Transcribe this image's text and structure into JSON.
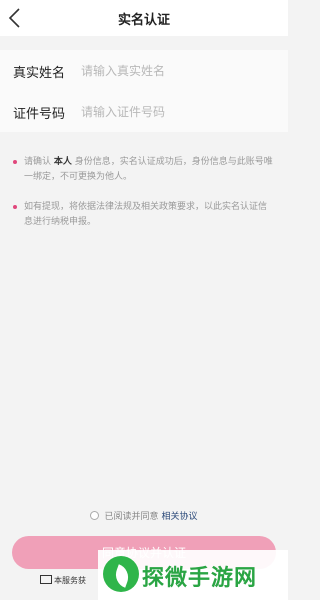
{
  "header": {
    "title": "实名认证",
    "back_icon": "chevron-left-icon"
  },
  "form": {
    "name": {
      "label": "真实姓名",
      "placeholder": "请输入真实姓名",
      "value": ""
    },
    "id_number": {
      "label": "证件号码",
      "placeholder": "请输入证件号码",
      "value": ""
    }
  },
  "notes": [
    {
      "prefix": "请确认",
      "highlight": "本人",
      "text": "身份信息，实名认证成功后，身份信息与此账号唯一绑定，不可更换为他人。"
    },
    {
      "text": "如有提现，将依据法律法规及相关政策要求，以此实名认证信息进行纳税申报。"
    }
  ],
  "agreement": {
    "text": "已阅读并同意",
    "link": "相关协议",
    "checked": false
  },
  "submit_label": "同意协议并认证",
  "service_text": "本服务获",
  "watermark": {
    "text": "探微手游网"
  },
  "colors": {
    "accent": "#e0477c",
    "button": "#f0a0b8",
    "link": "#2c4a7a"
  }
}
